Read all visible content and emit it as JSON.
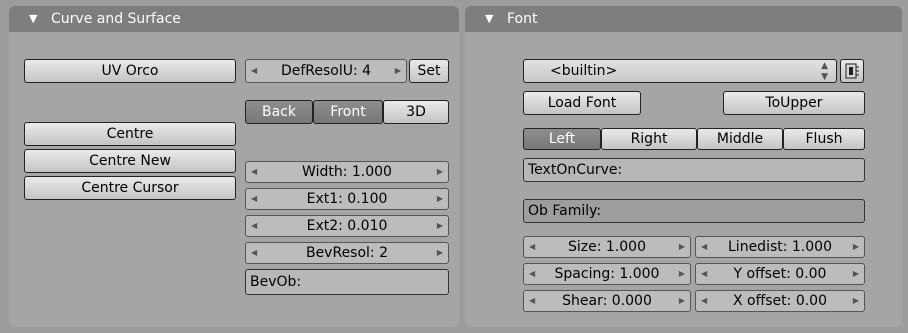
{
  "left_panel": {
    "title": "Curve and Surface",
    "uv_orco": "UV Orco",
    "def_resol_u": "DefResolU: 4",
    "set": "Set",
    "back": "Back",
    "front": "Front",
    "three_d": "3D",
    "centre": "Centre",
    "centre_new": "Centre New",
    "centre_cursor": "Centre Cursor",
    "width": "Width: 1.000",
    "ext1": "Ext1: 0.100",
    "ext2": "Ext2: 0.010",
    "bev_resol": "BevResol: 2",
    "bev_ob": "BevOb:"
  },
  "right_panel": {
    "title": "Font",
    "font_select": "<builtin>",
    "load_font": "Load Font",
    "to_upper": "ToUpper",
    "align": [
      "Left",
      "Right",
      "Middle",
      "Flush"
    ],
    "align_selected": "Left",
    "text_on_curve": "TextOnCurve:",
    "ob_family": "Ob Family:",
    "size": "Size: 1.000",
    "linedist": "Linedist: 1.000",
    "spacing": "Spacing: 1.000",
    "y_offset": "Y offset: 0.00",
    "shear": "Shear: 0.000",
    "x_offset": "X offset: 0.00"
  },
  "icons": {
    "collapse": "triangle-down-icon",
    "browse": "file-browse-icon",
    "updown": "up-down-arrows-icon",
    "arrow_left": "left-arrow-icon",
    "arrow_right": "right-arrow-icon"
  }
}
